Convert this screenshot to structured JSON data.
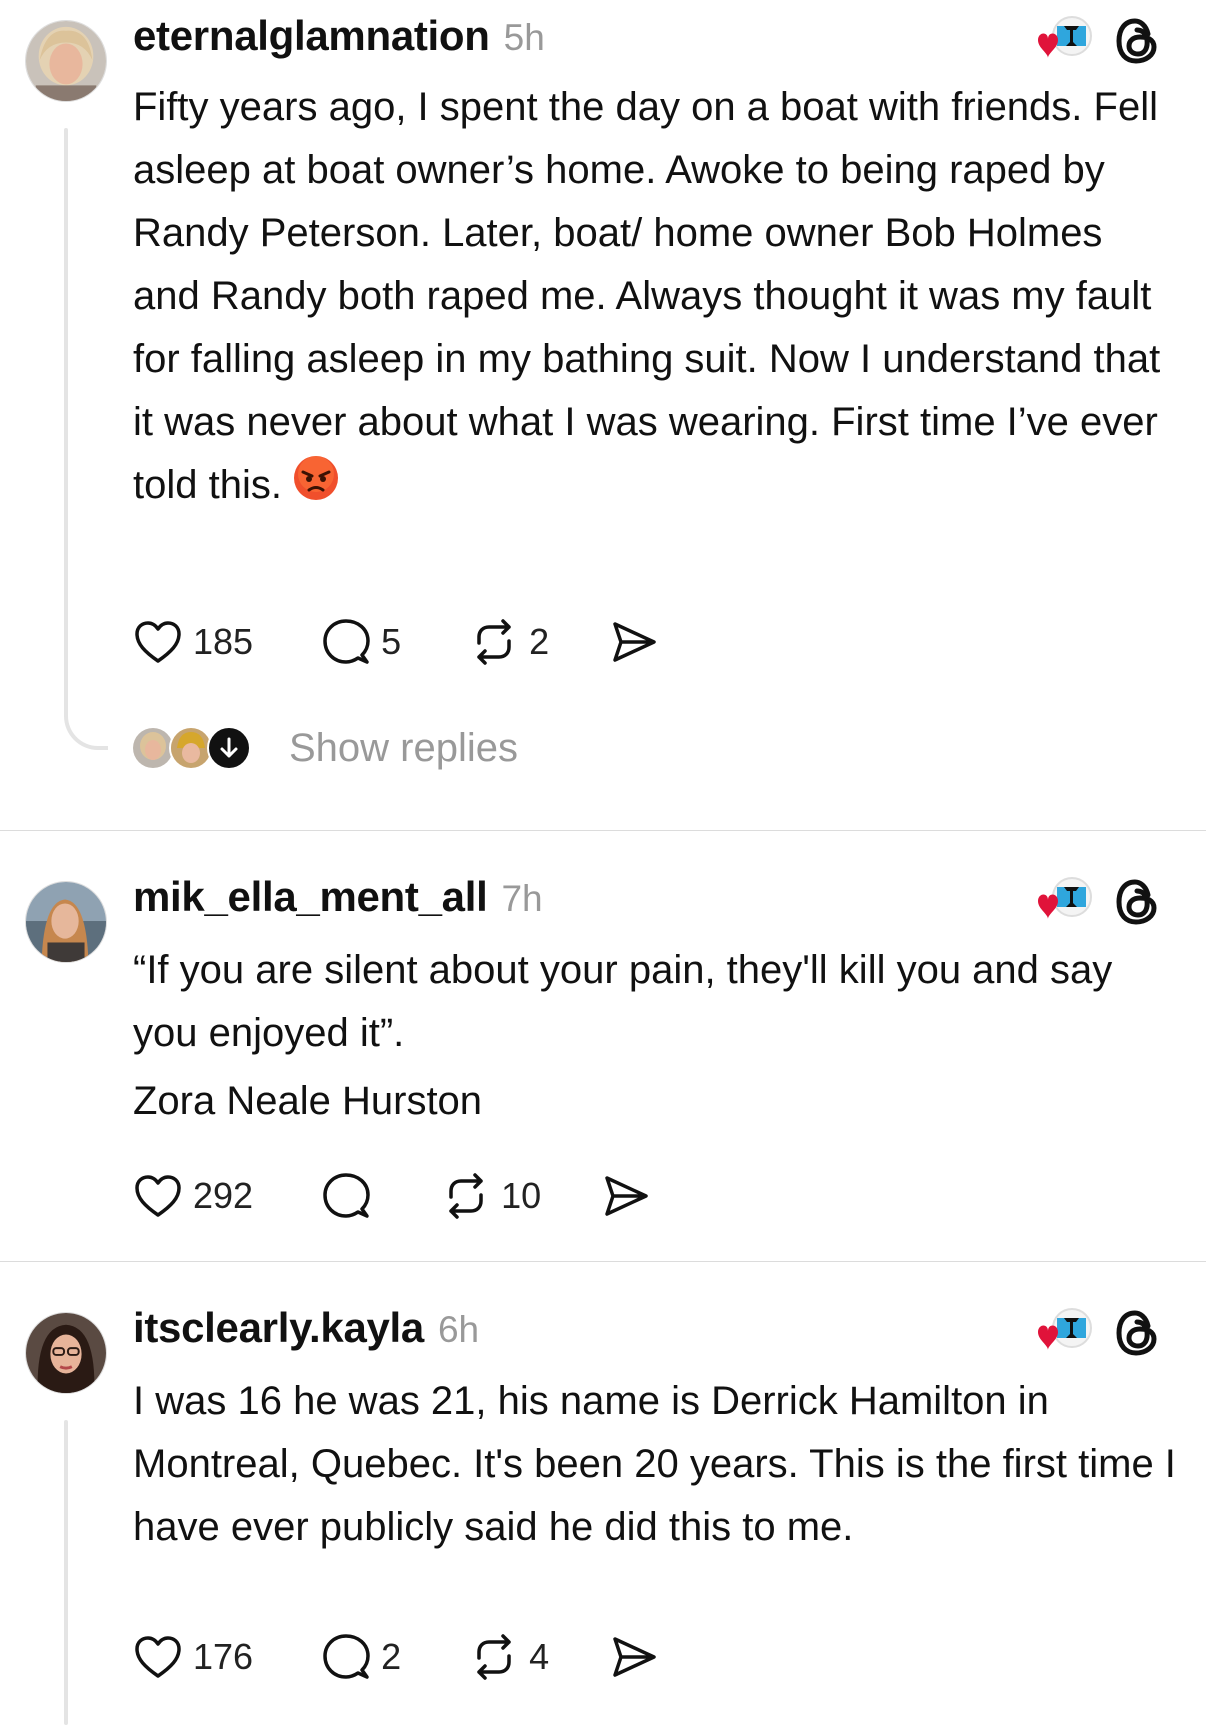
{
  "posts": [
    {
      "username": "eternalglamnation",
      "time": "5h",
      "text": "Fifty years ago, I spent the day on a boat with friends. Fell asleep at boat owner’s home. Awoke to being raped by Randy Peterson. Later, boat/ home owner Bob Holmes and Randy both raped me. Always thought it was my fault for falling asleep in my bathing suit. Now I understand that it was never about what I was wearing. First time I’ve ever told this.",
      "emoji": "angry-face",
      "likes": "185",
      "comments": "5",
      "reposts": "2",
      "show_replies": "Show replies"
    },
    {
      "username": "mik_ella_ment_all",
      "time": "7h",
      "text": "“If you are silent about your pain, they'll kill you and say you enjoyed it”.",
      "author": "Zora Neale Hurston",
      "likes": "292",
      "comments": "",
      "reposts": "10"
    },
    {
      "username": "itsclearly.kayla",
      "time": "6h",
      "text": "I was 16 he was 21, his name is Derrick Hamilton in Montreal, Quebec. It's  been 20 years. This is the first time I have ever publicly said he did this to me.",
      "likes": "176",
      "comments": "2",
      "reposts": "4"
    }
  ],
  "icons": {
    "like": "heart-outline-icon",
    "comment": "speech-bubble-icon",
    "repost": "repost-arrows-icon",
    "share": "send-plane-icon",
    "badge": "heart-flag-badge-icon",
    "platform": "threads-logo-icon"
  },
  "colors": {
    "text": "#111111",
    "muted": "#999999",
    "divider": "#dcdcdc",
    "heart": "#e0133a",
    "flag_blue": "#2fa6dd"
  }
}
